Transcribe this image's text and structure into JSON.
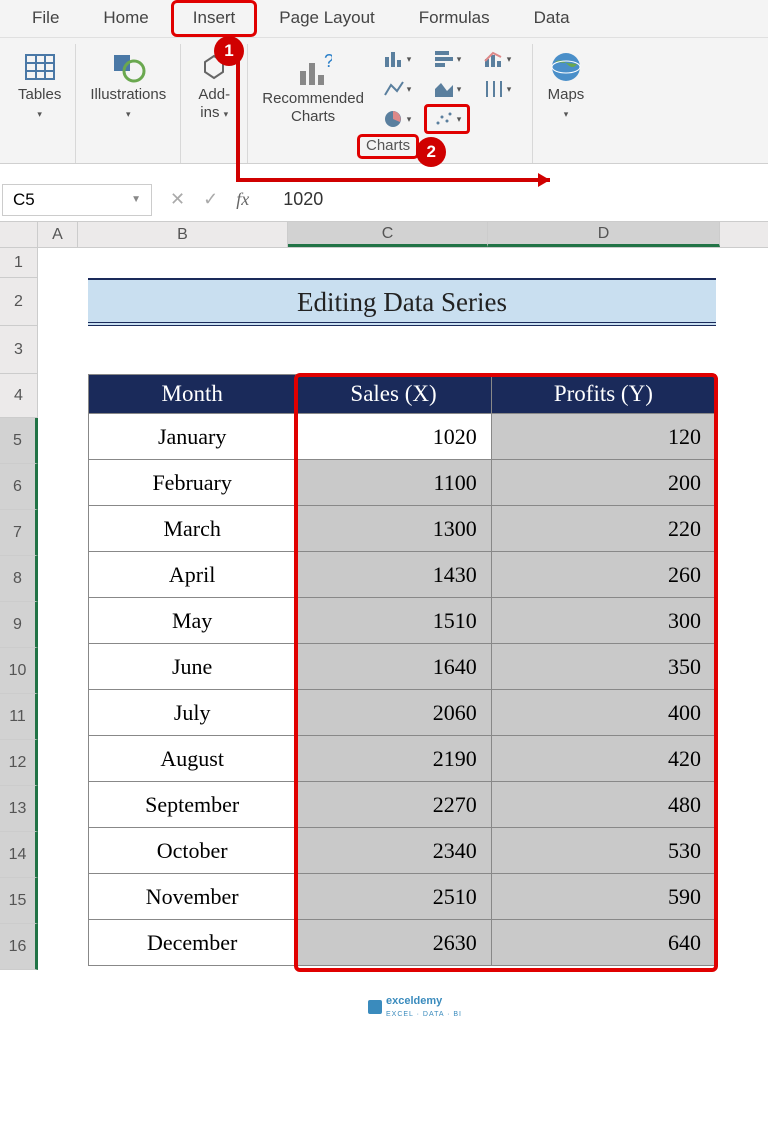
{
  "tabs": {
    "file": "File",
    "home": "Home",
    "insert": "Insert",
    "pagelayout": "Page Layout",
    "formulas": "Formulas",
    "data": "Data"
  },
  "ribbon": {
    "tables": "Tables",
    "illustrations": "Illustrations",
    "addins": "Add-\nins",
    "recommended": "Recommended\nCharts",
    "charts": "Charts",
    "maps": "Maps"
  },
  "formula_bar": {
    "name_box": "C5",
    "value": "1020"
  },
  "columns": {
    "A": "A",
    "B": "B",
    "C": "C",
    "D": "D"
  },
  "row_labels": [
    "1",
    "2",
    "3",
    "4",
    "5",
    "6",
    "7",
    "8",
    "9",
    "10",
    "11",
    "12",
    "13",
    "14",
    "15",
    "16"
  ],
  "sheet": {
    "title": "Editing Data Series",
    "headers": {
      "month": "Month",
      "x": "Sales (X)",
      "y": "Profits (Y)"
    },
    "rows": [
      {
        "month": "January",
        "x": "1020",
        "y": "120"
      },
      {
        "month": "February",
        "x": "1100",
        "y": "200"
      },
      {
        "month": "March",
        "x": "1300",
        "y": "220"
      },
      {
        "month": "April",
        "x": "1430",
        "y": "260"
      },
      {
        "month": "May",
        "x": "1510",
        "y": "300"
      },
      {
        "month": "June",
        "x": "1640",
        "y": "350"
      },
      {
        "month": "July",
        "x": "2060",
        "y": "400"
      },
      {
        "month": "August",
        "x": "2190",
        "y": "420"
      },
      {
        "month": "September",
        "x": "2270",
        "y": "480"
      },
      {
        "month": "October",
        "x": "2340",
        "y": "530"
      },
      {
        "month": "November",
        "x": "2510",
        "y": "590"
      },
      {
        "month": "December",
        "x": "2630",
        "y": "640"
      }
    ]
  },
  "annotations": {
    "step1": "1",
    "step2": "2"
  },
  "watermark": {
    "text": "exceldemy",
    "sub": "EXCEL · DATA · BI"
  }
}
